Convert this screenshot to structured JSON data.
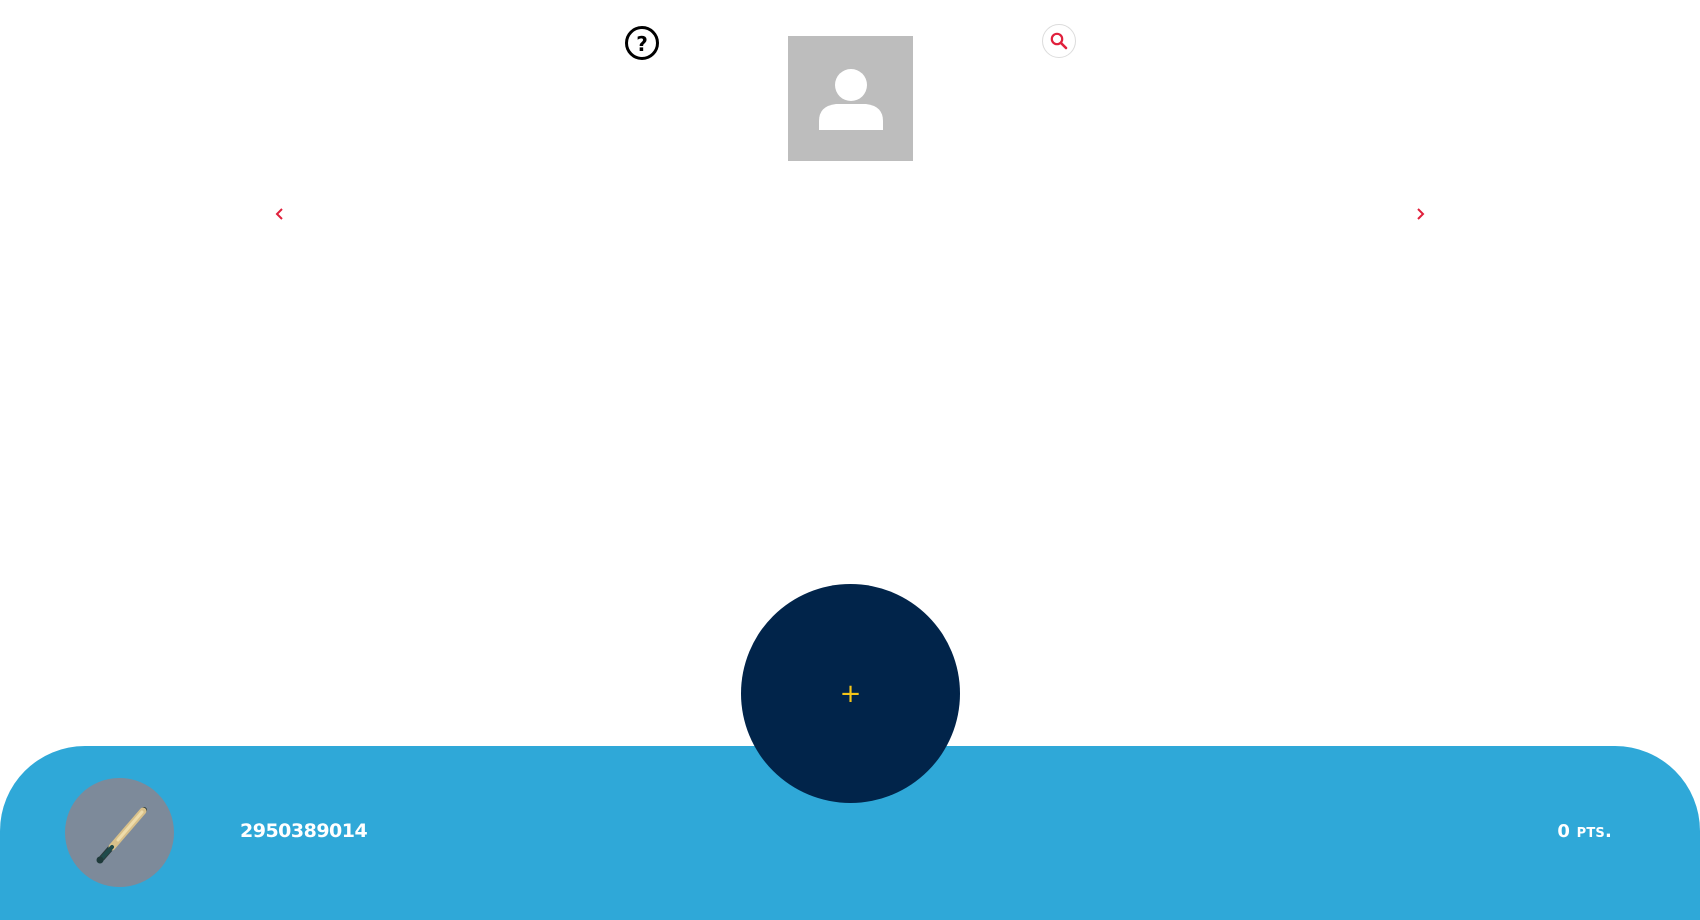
{
  "header": {
    "help_icon": "question-circle-icon",
    "help_glyph": "?",
    "avatar_icon": "person-placeholder-icon",
    "search_icon": "search-icon"
  },
  "carousel": {
    "prev_icon": "chevron-left-icon",
    "next_icon": "chevron-right-icon"
  },
  "fab": {
    "icon": "plus-icon",
    "glyph": "+"
  },
  "footer": {
    "avatar_icon": "baseball-bat-icon",
    "user_id": "2950389014",
    "points": "0 pts."
  },
  "colors": {
    "accent": "#e0203c",
    "footer_bg": "#2fa8d8",
    "fab_bg": "#01244a",
    "fab_plus": "#f5c518",
    "avatar_bg": "#bdbdbd",
    "bat_avatar_bg": "#7d8a9a"
  }
}
